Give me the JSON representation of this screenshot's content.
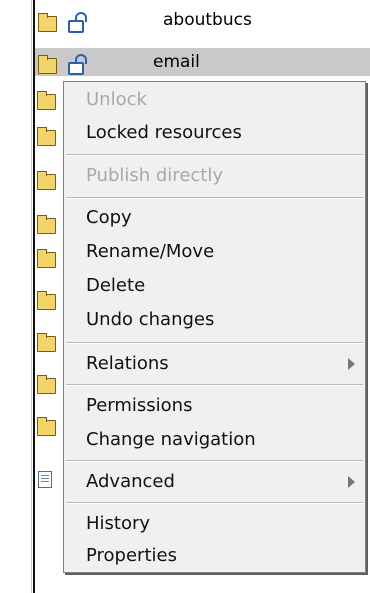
{
  "tree": {
    "rows": [
      {
        "label": "aboutbucs",
        "selected": false
      },
      {
        "label": "email",
        "selected": true
      }
    ]
  },
  "context_menu": {
    "items": [
      {
        "label": "Unlock",
        "enabled": false
      },
      {
        "label": "Locked resources",
        "enabled": true
      },
      {
        "label": "Publish directly",
        "enabled": false
      },
      {
        "label": "Copy",
        "enabled": true
      },
      {
        "label": "Rename/Move",
        "enabled": true
      },
      {
        "label": "Delete",
        "enabled": true
      },
      {
        "label": "Undo changes",
        "enabled": true
      },
      {
        "label": "Relations",
        "enabled": true,
        "submenu": true
      },
      {
        "label": "Permissions",
        "enabled": true
      },
      {
        "label": "Change navigation",
        "enabled": true
      },
      {
        "label": "Advanced",
        "enabled": true,
        "submenu": true
      },
      {
        "label": "History",
        "enabled": true
      },
      {
        "label": "Properties",
        "enabled": true
      }
    ]
  },
  "icons": {
    "folder": "folder-icon",
    "lock": "unlocked-padlock-icon",
    "document": "document-icon",
    "submenu": "submenu-arrow-icon"
  },
  "colors": {
    "selected_row": "#c9c9c9",
    "menu_background": "#f0f0f0",
    "disabled_text": "#a8a8a8",
    "folder": "#f3d46a",
    "lock": "#2a5fb0"
  }
}
